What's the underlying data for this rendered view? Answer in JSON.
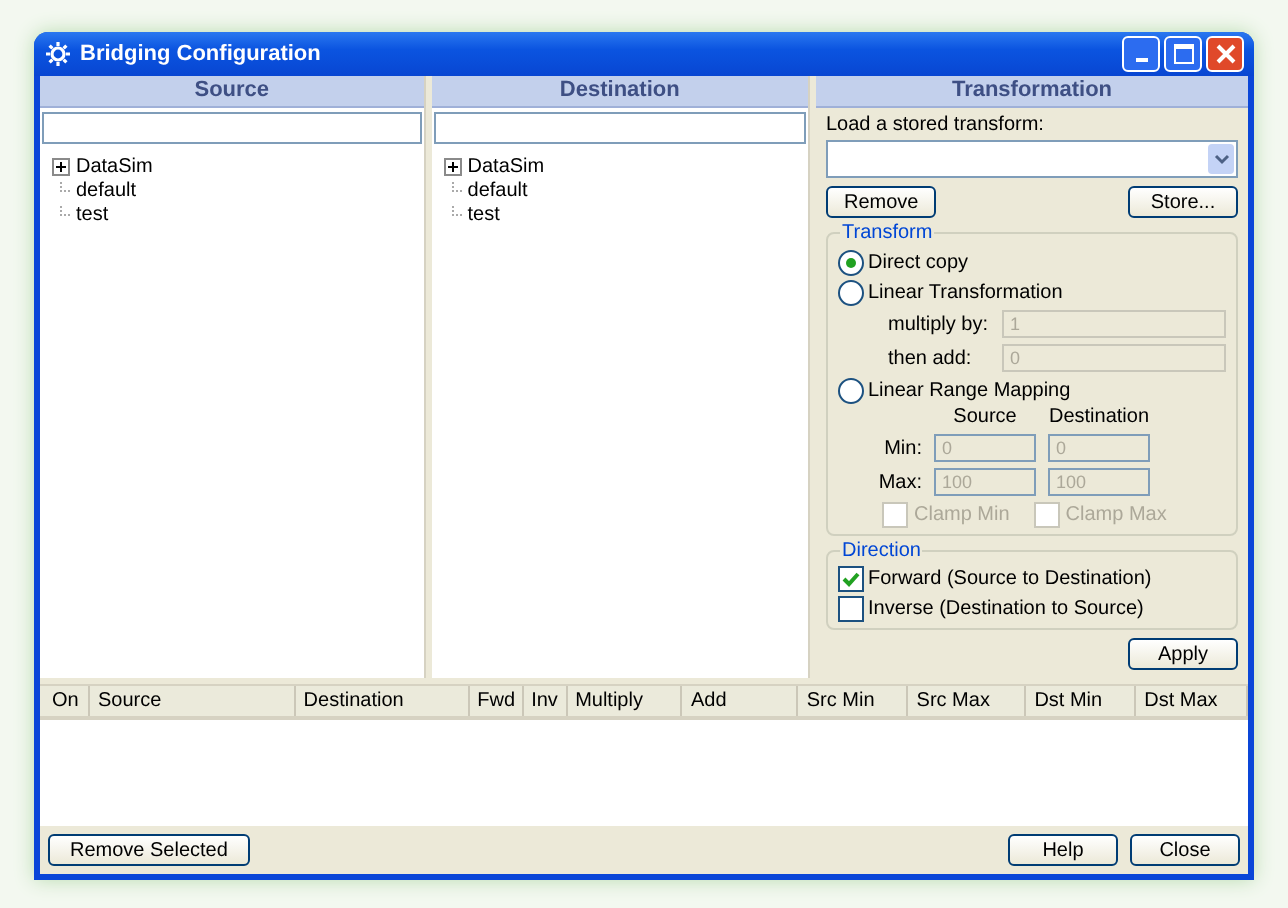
{
  "window": {
    "title": "Bridging Configuration"
  },
  "source": {
    "header": "Source",
    "tree": [
      {
        "label": "DataSim",
        "kind": "group",
        "expanded": false
      },
      {
        "label": "default",
        "kind": "leaf"
      },
      {
        "label": "test",
        "kind": "leaf"
      }
    ]
  },
  "destination": {
    "header": "Destination",
    "tree": [
      {
        "label": "DataSim",
        "kind": "group",
        "expanded": false
      },
      {
        "label": "default",
        "kind": "leaf"
      },
      {
        "label": "test",
        "kind": "leaf"
      }
    ]
  },
  "transformation": {
    "header": "Transformation",
    "load_label": "Load a stored transform:",
    "remove_button": "Remove",
    "store_button": "Store...",
    "transform": {
      "legend": "Transform",
      "options": [
        {
          "label": "Direct copy",
          "selected": true
        },
        {
          "label": "Linear Transformation",
          "selected": false
        },
        {
          "label": "Linear Range Mapping",
          "selected": false
        }
      ],
      "multiply_label": "multiply by:",
      "multiply_value": "1",
      "add_label": "then add:",
      "add_value": "0",
      "disabled": true,
      "source_heading": "Source",
      "destination_heading": "Destination",
      "min_label": "Min:",
      "max_label": "Max:",
      "src_min": "0",
      "dst_min": "0",
      "src_max": "100",
      "dst_max": "100",
      "clamps": [
        {
          "label": "Clamp Min",
          "checked": false
        },
        {
          "label": "Clamp Max",
          "checked": false
        }
      ]
    },
    "direction": {
      "legend": "Direction",
      "options": [
        {
          "label": "Forward (Source to Destination)",
          "checked": true
        },
        {
          "label": "Inverse (Destination to Source)",
          "checked": false
        }
      ]
    },
    "apply_button": "Apply"
  },
  "table": {
    "columns": [
      "On",
      "Source",
      "Destination",
      "Fwd",
      "Inv",
      "Multiply",
      "Add",
      "Src Min",
      "Src Max",
      "Dst Min",
      "Dst Max"
    ]
  },
  "buttons": {
    "remove_selected": "Remove Selected",
    "help": "Help",
    "close": "Close"
  }
}
